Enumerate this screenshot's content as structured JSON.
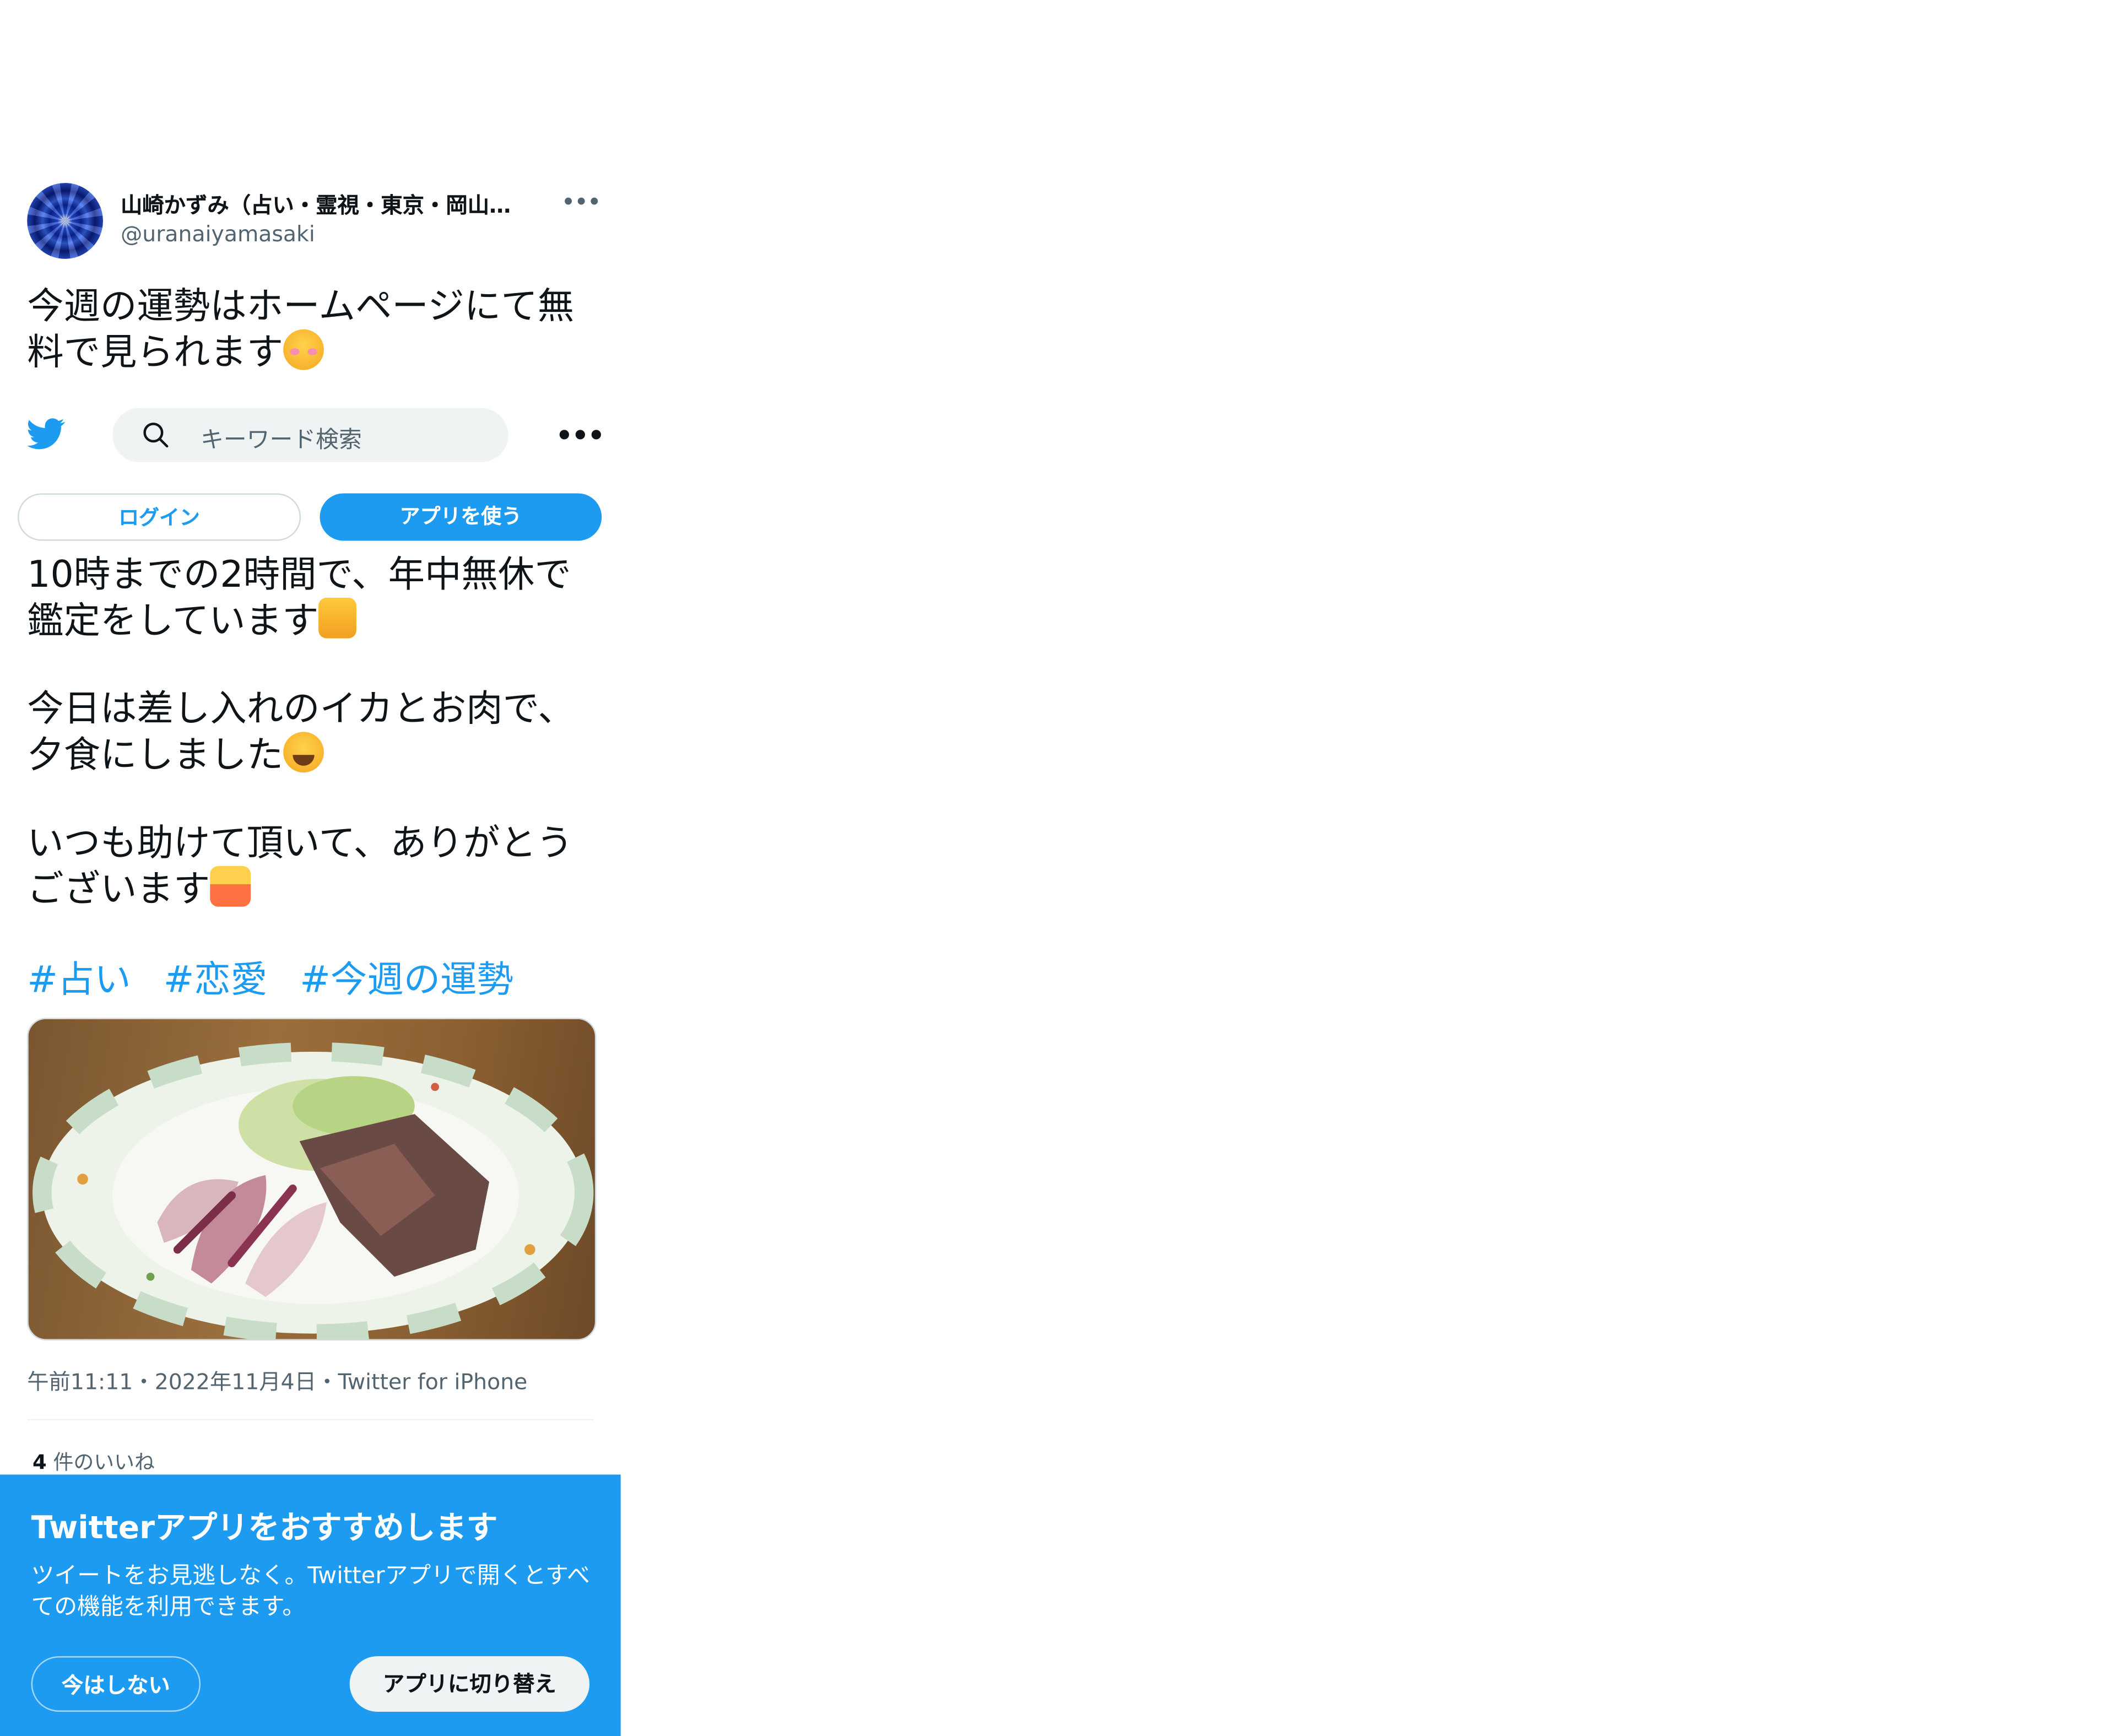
{
  "tweet": {
    "display_name": "山崎かずみ（占い・霊視・東京・岡山…",
    "handle": "@uranaiyamasaki",
    "text_line1": "今週の運勢はホームページにて無",
    "text_line2": "料で見られます",
    "text_line3": "10時までの2時間で、年中無休で",
    "text_line4": "鑑定をしています",
    "text_line5": "今日は差し入れのイカとお肉で、",
    "text_line6": "夕食にしました",
    "text_line7": "いつも助けて頂いて、ありがとう",
    "text_line8": "ございます",
    "hashtags": [
      "#占い",
      "#恋愛",
      "#今週の運勢"
    ],
    "timestamp": "午前11:11・2022年11月4日・Twitter for iPhone",
    "likes_count": "4",
    "likes_label": " 件のいいね",
    "more_icon": "more-horizontal-icon"
  },
  "nav": {
    "search_placeholder": "キーワード検索",
    "login_label": "ログイン",
    "use_app_label": "アプリを使う"
  },
  "promo": {
    "title": "Twitterアプリをおすすめします",
    "body": "ツイートをお見逃しなく。Twitterアプリで開くとすべての機能を利用できます。",
    "not_now_label": "今はしない",
    "switch_label": "アプリに切り替え"
  },
  "colors": {
    "accent": "#1d9bf0",
    "text_primary": "#0f1419",
    "text_secondary": "#536471"
  }
}
